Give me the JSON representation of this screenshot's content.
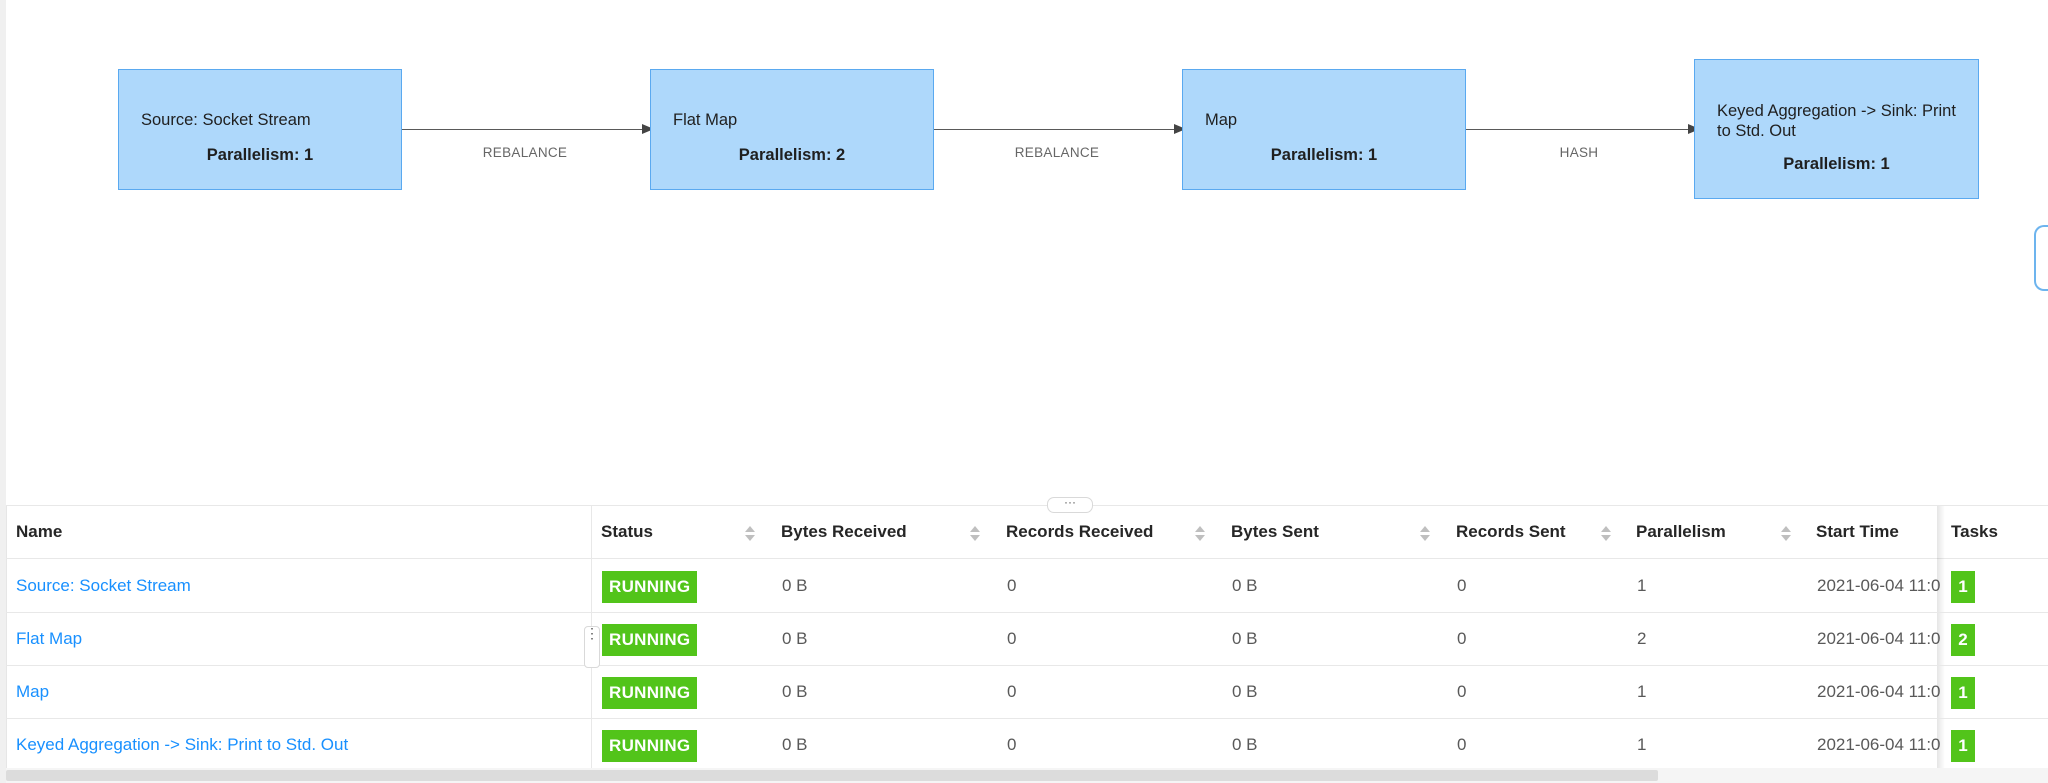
{
  "graph": {
    "nodes": [
      {
        "title": "Source: Socket Stream",
        "parallelism": "Parallelism: 1"
      },
      {
        "title": "Flat Map",
        "parallelism": "Parallelism: 2"
      },
      {
        "title": "Map",
        "parallelism": "Parallelism: 1"
      },
      {
        "title": "Keyed Aggregation -> Sink: Print to Std. Out",
        "parallelism": "Parallelism: 1"
      }
    ],
    "edges": [
      {
        "label": "REBALANCE"
      },
      {
        "label": "REBALANCE"
      },
      {
        "label": "HASH"
      }
    ]
  },
  "splitter": {
    "handle": "···"
  },
  "table": {
    "headers": {
      "name": "Name",
      "status": "Status",
      "bytes_received": "Bytes Received",
      "records_received": "Records Received",
      "bytes_sent": "Bytes Sent",
      "records_sent": "Records Sent",
      "parallelism": "Parallelism",
      "start_time": "Start Time",
      "tasks": "Tasks"
    },
    "rows": [
      {
        "name": "Source: Socket Stream",
        "status": "RUNNING",
        "bytes_received": "0 B",
        "records_received": "0",
        "bytes_sent": "0 B",
        "records_sent": "0",
        "parallelism": "1",
        "start_time": "2021-06-04 11:0",
        "tasks": "1"
      },
      {
        "name": "Flat Map",
        "status": "RUNNING",
        "bytes_received": "0 B",
        "records_received": "0",
        "bytes_sent": "0 B",
        "records_sent": "0",
        "parallelism": "2",
        "start_time": "2021-06-04 11:0",
        "tasks": "2"
      },
      {
        "name": "Map",
        "status": "RUNNING",
        "bytes_received": "0 B",
        "records_received": "0",
        "bytes_sent": "0 B",
        "records_sent": "0",
        "parallelism": "1",
        "start_time": "2021-06-04 11:0",
        "tasks": "1"
      },
      {
        "name": "Keyed Aggregation -> Sink: Print to Std. Out",
        "status": "RUNNING",
        "bytes_received": "0 B",
        "records_received": "0",
        "bytes_sent": "0 B",
        "records_sent": "0",
        "parallelism": "1",
        "start_time": "2021-06-04 11:0",
        "tasks": "1"
      }
    ]
  },
  "resize_handle": "⋮",
  "colors": {
    "node_fill": "#aed8fb",
    "node_border": "#5aa9f0",
    "running": "#52c41a",
    "link": "#1890ff"
  }
}
